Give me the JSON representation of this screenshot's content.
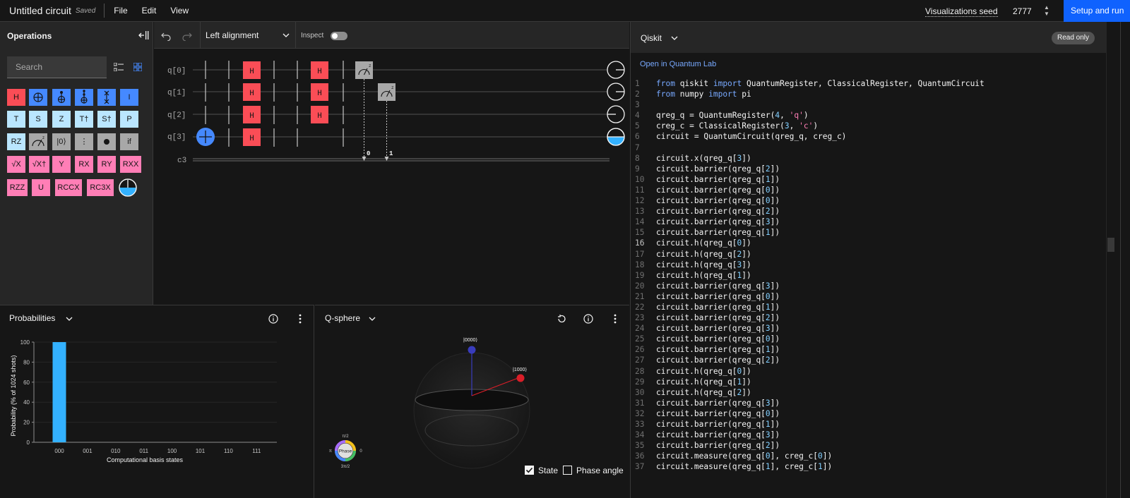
{
  "topbar": {
    "title": "Untitled circuit",
    "saved": "Saved",
    "menu": [
      "File",
      "Edit",
      "View"
    ],
    "vis_seed_label": "Visualizations seed",
    "vis_seed_value": "2777",
    "setup_run": "Setup and run"
  },
  "operations": {
    "title": "Operations",
    "search_placeholder": "Search",
    "gates": {
      "H": "H",
      "I": "I",
      "T": "T",
      "S": "S",
      "Z": "Z",
      "Tdg": "T†",
      "Sdg": "S†",
      "P": "P",
      "RZ": "RZ",
      "reset": "|0⟩",
      "barrier": "⋮",
      "if": "if",
      "sqrtx": "√X",
      "sqrtxdg": "√X†",
      "Y": "Y",
      "RX": "RX",
      "RY": "RY",
      "RXX": "RXX",
      "RZZ": "RZZ",
      "U": "U",
      "RCCX": "RCCX",
      "RC3X": "RC3X"
    }
  },
  "circuit_toolbar": {
    "alignment": "Left alignment",
    "inspect": "Inspect"
  },
  "circuit": {
    "qubits": [
      "q[0]",
      "q[1]",
      "q[2]",
      "q[3]"
    ],
    "classical": "c3",
    "h_label": "H",
    "measure_bits": [
      "0",
      "1"
    ]
  },
  "probabilities": {
    "title": "Probabilities",
    "chart_data": {
      "type": "bar",
      "categories": [
        "000",
        "001",
        "010",
        "011",
        "100",
        "101",
        "110",
        "111"
      ],
      "values": [
        100,
        0,
        0,
        0,
        0,
        0,
        0,
        0
      ],
      "xlabel": "Computational basis states",
      "ylabel": "Probability (% of 1024 shots)",
      "ylim": [
        0,
        100
      ],
      "yticks": [
        "0",
        "20",
        "40",
        "60",
        "80",
        "100"
      ],
      "bar_color": "#33b1ff"
    }
  },
  "qsphere": {
    "title": "Q-sphere",
    "state_top": "|0000⟩",
    "state_side": "|1000⟩",
    "phase_label": "Phase",
    "phase_top": "π/2",
    "phase_left": "π",
    "phase_right": "0",
    "phase_bottom": "3π/2",
    "state_checkbox": "State",
    "phase_angle_checkbox": "Phase angle"
  },
  "code": {
    "language": "Qiskit",
    "read_only": "Read only",
    "open_quantum_lab": "Open in Quantum Lab",
    "active_line": 16,
    "lines": [
      "from qiskit import QuantumRegister, ClassicalRegister, QuantumCircuit",
      "from numpy import pi",
      "",
      "qreg_q = QuantumRegister(4, 'q')",
      "creg_c = ClassicalRegister(3, 'c')",
      "circuit = QuantumCircuit(qreg_q, creg_c)",
      "",
      "circuit.x(qreg_q[3])",
      "circuit.barrier(qreg_q[2])",
      "circuit.barrier(qreg_q[1])",
      "circuit.barrier(qreg_q[0])",
      "circuit.barrier(qreg_q[0])",
      "circuit.barrier(qreg_q[2])",
      "circuit.barrier(qreg_q[3])",
      "circuit.barrier(qreg_q[1])",
      "circuit.h(qreg_q[0])",
      "circuit.h(qreg_q[2])",
      "circuit.h(qreg_q[3])",
      "circuit.h(qreg_q[1])",
      "circuit.barrier(qreg_q[3])",
      "circuit.barrier(qreg_q[0])",
      "circuit.barrier(qreg_q[1])",
      "circuit.barrier(qreg_q[2])",
      "circuit.barrier(qreg_q[3])",
      "circuit.barrier(qreg_q[0])",
      "circuit.barrier(qreg_q[1])",
      "circuit.barrier(qreg_q[2])",
      "circuit.h(qreg_q[0])",
      "circuit.h(qreg_q[1])",
      "circuit.h(qreg_q[2])",
      "circuit.barrier(qreg_q[3])",
      "circuit.barrier(qreg_q[0])",
      "circuit.barrier(qreg_q[1])",
      "circuit.barrier(qreg_q[3])",
      "circuit.barrier(qreg_q[2])",
      "circuit.measure(qreg_q[0], creg_c[0])",
      "circuit.measure(qreg_q[1], creg_c[1])"
    ]
  },
  "colors": {
    "accent": "#0f62fe",
    "h_gate": "#fa4d56",
    "x_gate": "#4589ff",
    "phase_gate": "#bae6ff",
    "param_gate": "#ff7eb6",
    "prob_bar": "#33b1ff"
  }
}
